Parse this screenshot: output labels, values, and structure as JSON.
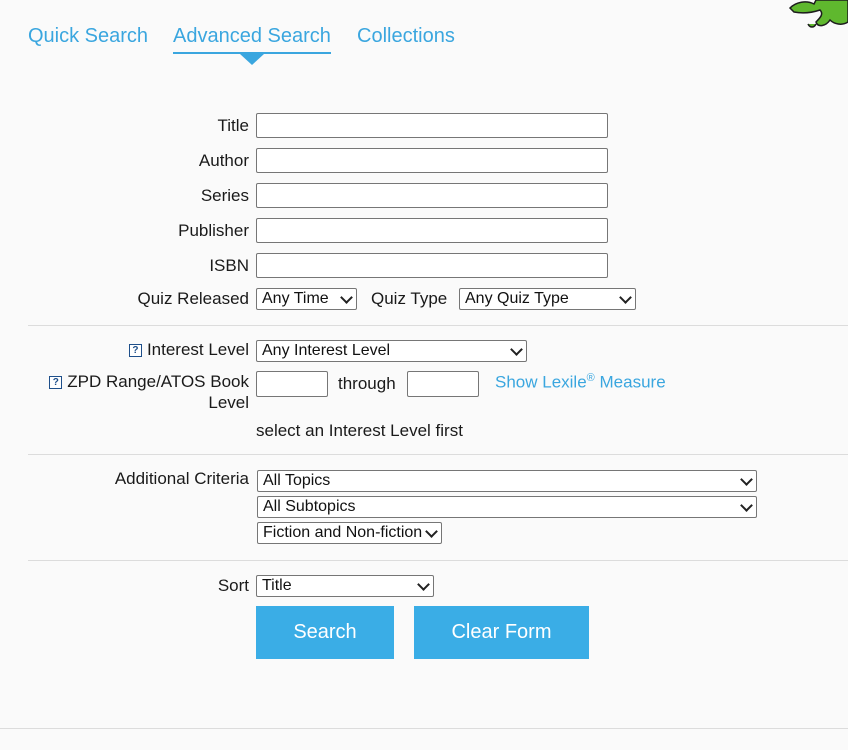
{
  "tabs": [
    {
      "label": "Quick Search"
    },
    {
      "label": "Advanced Search"
    },
    {
      "label": "Collections"
    }
  ],
  "active_tab": "Advanced Search",
  "form": {
    "title_label": "Title",
    "author_label": "Author",
    "series_label": "Series",
    "publisher_label": "Publisher",
    "isbn_label": "ISBN",
    "title_value": "",
    "author_value": "",
    "series_value": "",
    "publisher_value": "",
    "isbn_value": "",
    "quiz_released_label": "Quiz Released",
    "quiz_released_value": "Any Time",
    "quiz_type_label": "Quiz Type",
    "quiz_type_value": "Any Quiz Type",
    "interest_level_label": "Interest Level",
    "interest_level_value": "Any Interest Level",
    "zpd_label_line1": "ZPD Range/ATOS Book",
    "zpd_label_line2": "Level",
    "zpd_from": "",
    "zpd_to": "",
    "through_label": "through",
    "lexile_link_pre": "Show Lexile",
    "lexile_reg": "®",
    "lexile_link_post": " Measure",
    "interest_hint": "select an Interest Level first",
    "additional_criteria_label": "Additional Criteria",
    "topics_value": "All Topics",
    "subtopics_value": "All Subtopics",
    "fiction_value": "Fiction and Non-fiction",
    "sort_label": "Sort",
    "sort_value": "Title"
  },
  "buttons": {
    "search": "Search",
    "clear": "Clear Form"
  },
  "help_icon_glyph": "?",
  "colors": {
    "accent": "#3aa6df",
    "button": "#3aade6",
    "corner_art": "#5fb82e"
  }
}
